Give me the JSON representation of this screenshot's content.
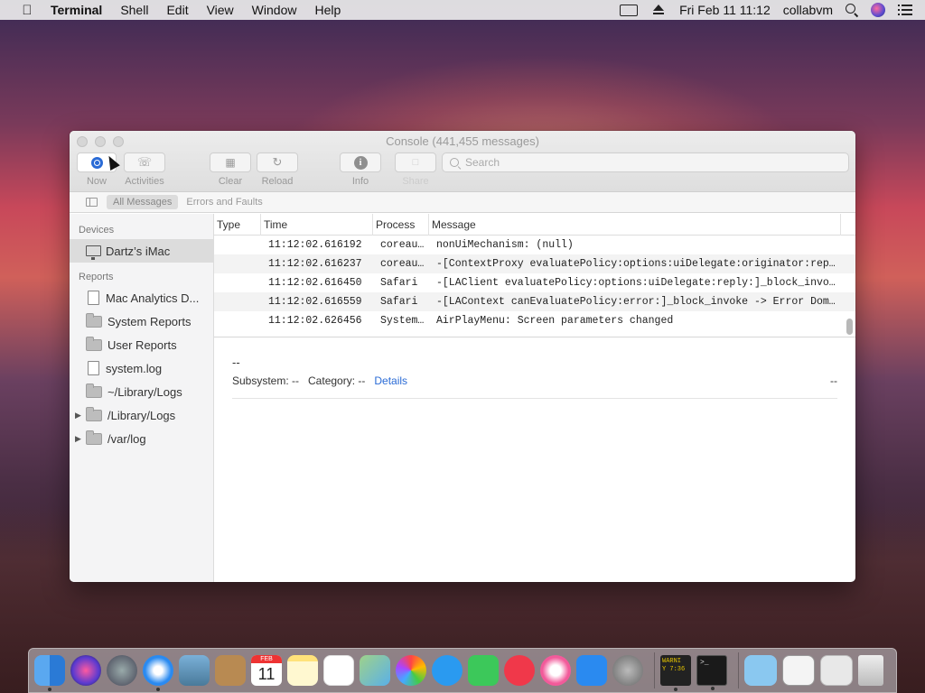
{
  "menubar": {
    "app_name": "Terminal",
    "items": [
      "Shell",
      "Edit",
      "View",
      "Window",
      "Help"
    ],
    "clock": "Fri Feb 11  11:12",
    "user": "collabvm",
    "icons": [
      "display-icon",
      "eject-icon",
      "search-icon",
      "siri-icon",
      "control-center-icon"
    ]
  },
  "window": {
    "title": "Console (441,455 messages)",
    "toolbar": {
      "now_label": "Now",
      "activities_label": "Activities",
      "clear_label": "Clear",
      "reload_label": "Reload",
      "info_label": "Info",
      "share_label": "Share"
    },
    "search": {
      "placeholder": "Search",
      "value": ""
    },
    "filters": {
      "all_messages": "All Messages",
      "errors_and_faults": "Errors and Faults"
    },
    "sidebar": {
      "devices_header": "Devices",
      "device": "Dartz’s iMac",
      "reports_header": "Reports",
      "reports": [
        {
          "label": "Mac Analytics D...",
          "icon": "doc-icon",
          "expandable": false
        },
        {
          "label": "System Reports",
          "icon": "folder-icon",
          "expandable": false
        },
        {
          "label": "User Reports",
          "icon": "folder-icon",
          "expandable": false
        },
        {
          "label": "system.log",
          "icon": "doc-icon",
          "expandable": false
        },
        {
          "label": "~/Library/Logs",
          "icon": "folder-icon",
          "expandable": false
        },
        {
          "label": "/Library/Logs",
          "icon": "folder-icon",
          "expandable": true
        },
        {
          "label": "/var/log",
          "icon": "folder-icon",
          "expandable": true
        }
      ]
    },
    "table": {
      "columns": [
        "Type",
        "Time",
        "Process",
        "Message"
      ],
      "rows": [
        {
          "type": "",
          "time": "11:12:02.616192",
          "process": "coreau…",
          "message": "nonUiMechanism: (null)"
        },
        {
          "type": "",
          "time": "11:12:02.616237",
          "process": "coreau…",
          "message": "-[ContextProxy evaluatePolicy:options:uiDelegate:originator:rep…"
        },
        {
          "type": "",
          "time": "11:12:02.616450",
          "process": "Safari",
          "message": "-[LAClient evaluatePolicy:options:uiDelegate:reply:]_block_invo…"
        },
        {
          "type": "",
          "time": "11:12:02.616559",
          "process": "Safari",
          "message": "-[LAContext canEvaluatePolicy:error:]_block_invoke -> Error Dom…"
        },
        {
          "type": "",
          "time": "11:12:02.626456",
          "process": "System…",
          "message": "AirPlayMenu: Screen parameters changed"
        }
      ]
    },
    "detail": {
      "title": "--",
      "subsystem": "Subsystem: --",
      "category": "Category: --",
      "details_link": "Details",
      "trailing": "--"
    }
  },
  "dock": {
    "calendar_month": "FEB",
    "calendar_day": "11",
    "console_text_1": "WARNI",
    "console_text_2": "Y 7:36",
    "terminal_text": ">_"
  },
  "colors": {
    "accent": "#2a6bd6",
    "sidebar_bg": "#f4f4f5",
    "selected_row": "#dcdcdc"
  }
}
